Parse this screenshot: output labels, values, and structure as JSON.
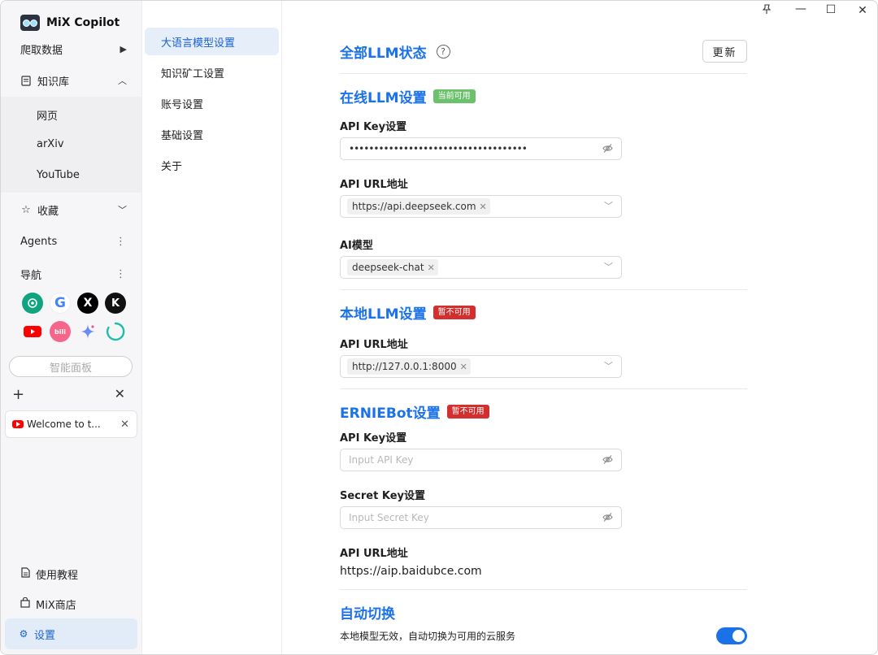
{
  "app": {
    "name": "MiX Copilot"
  },
  "sidebar": {
    "crawl": {
      "label": "爬取数据"
    },
    "knowledge_base": {
      "label": "知识库",
      "items": [
        "网页",
        "arXiv",
        "YouTube"
      ]
    },
    "favorites": {
      "label": "收藏"
    },
    "agents": {
      "label": "Agents"
    },
    "navigation": {
      "label": "导航"
    },
    "shortcuts": [
      {
        "name": "chatgpt",
        "glyph": "✺",
        "color": "#10a37f"
      },
      {
        "name": "google",
        "glyph": "G",
        "color": "#ffffff"
      },
      {
        "name": "x",
        "glyph": "𝕏",
        "color": "#000000"
      },
      {
        "name": "kimi",
        "glyph": "K",
        "color": "#111111"
      },
      {
        "name": "youtube",
        "glyph": "▶",
        "color": "#ff0000"
      },
      {
        "name": "bilibili",
        "glyph": "bili",
        "color": "#f7668a"
      },
      {
        "name": "gemini",
        "glyph": "✦",
        "color": "#ffffff"
      },
      {
        "name": "perplexity-ring",
        "glyph": "◌",
        "color": "#ffffff"
      }
    ],
    "smart_panel": "智能面板",
    "tabs": {
      "add": "+",
      "close_all": "✕",
      "items": [
        {
          "title": "Welcome to t...",
          "close": "✕"
        }
      ]
    },
    "tutorial": "使用教程",
    "store": "MiX商店",
    "settings": "设置"
  },
  "subnav": {
    "items": [
      "大语言模型设置",
      "知识矿工设置",
      "账号设置",
      "基础设置",
      "关于"
    ],
    "active_index": 0
  },
  "window_controls": {
    "pin": "⚲",
    "minimize": "—",
    "maximize": "☐",
    "close": "✕"
  },
  "main": {
    "all_status": {
      "title": "全部LLM状态",
      "help": "?",
      "update_button": "更新"
    },
    "online": {
      "title": "在线LLM设置",
      "status": "当前可用",
      "api_key_label": "API Key设置",
      "api_key_value": "••••••••••••••••••••••••••••••••••••",
      "api_url_label": "API URL地址",
      "api_url_value": "https://api.deepseek.com",
      "model_label": "AI模型",
      "model_value": "deepseek-chat"
    },
    "local": {
      "title": "本地LLM设置",
      "status": "暂不可用",
      "api_url_label": "API URL地址",
      "api_url_value": "http://127.0.0.1:8000"
    },
    "ernie": {
      "title": "ERNIEBot设置",
      "status": "暂不可用",
      "api_key_label": "API Key设置",
      "api_key_placeholder": "Input API Key",
      "secret_key_label": "Secret Key设置",
      "secret_key_placeholder": "Input Secret Key",
      "api_url_label": "API URL地址",
      "api_url_value": "https://aip.baidubce.com"
    },
    "auto_switch": {
      "title": "自动切换",
      "description": "本地模型无效，自动切换为可用的云服务",
      "enabled": true
    }
  }
}
